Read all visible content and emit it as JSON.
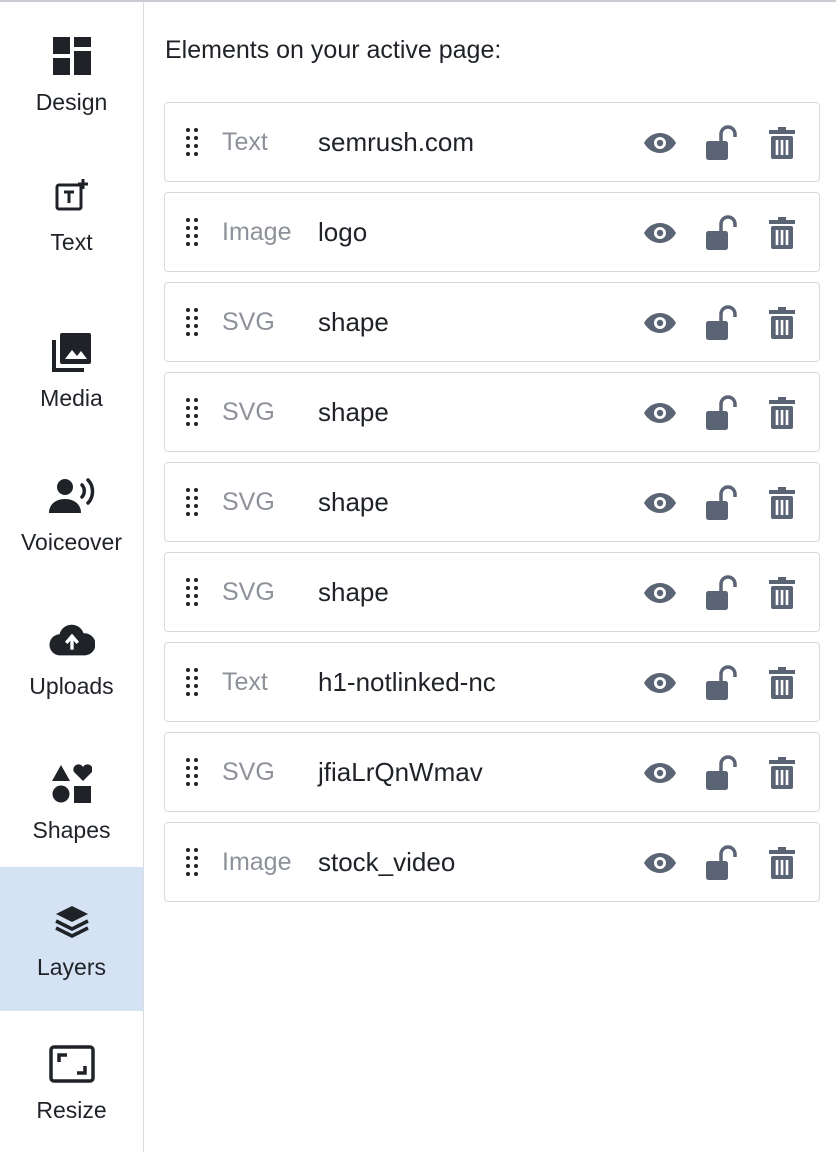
{
  "sidebar": {
    "items": [
      {
        "label": "Design",
        "icon": "design-grid-icon",
        "active": false
      },
      {
        "label": "Text",
        "icon": "add-text-icon",
        "active": false
      },
      {
        "label": "Media",
        "icon": "media-gallery-icon",
        "active": false
      },
      {
        "label": "Voiceover",
        "icon": "voiceover-speaker-icon",
        "active": false
      },
      {
        "label": "Uploads",
        "icon": "cloud-upload-icon",
        "active": false
      },
      {
        "label": "Shapes",
        "icon": "shapes-icon",
        "active": false
      },
      {
        "label": "Layers",
        "icon": "layers-icon",
        "active": true
      },
      {
        "label": "Resize",
        "icon": "resize-frame-icon",
        "active": false
      }
    ]
  },
  "main": {
    "heading": "Elements on your active page:",
    "layers": [
      {
        "type": "Text",
        "name": "semrush.com"
      },
      {
        "type": "Image",
        "name": "logo"
      },
      {
        "type": "SVG",
        "name": "shape"
      },
      {
        "type": "SVG",
        "name": "shape"
      },
      {
        "type": "SVG",
        "name": "shape"
      },
      {
        "type": "SVG",
        "name": "shape"
      },
      {
        "type": "Text",
        "name": "h1-notlinked-nc"
      },
      {
        "type": "SVG",
        "name": "jfiaLrQnWmav"
      },
      {
        "type": "Image",
        "name": "stock_video"
      }
    ],
    "row_actions": [
      "eye-icon",
      "unlock-icon",
      "trash-icon"
    ]
  },
  "colors": {
    "icon": "#5b6475",
    "active_bg": "#d5e2f4",
    "type_text": "#8d9199",
    "border": "#d6d9de"
  }
}
